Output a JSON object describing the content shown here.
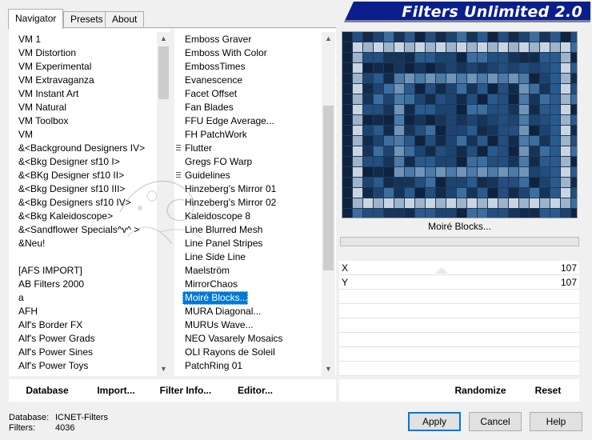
{
  "tabs": [
    "Navigator",
    "Presets",
    "About"
  ],
  "banner": {
    "title": "Filters Unlimited 2.0"
  },
  "categories": [
    {
      "label": "VM 1"
    },
    {
      "label": "VM Distortion"
    },
    {
      "label": "VM Experimental"
    },
    {
      "label": "VM Extravaganza"
    },
    {
      "label": "VM Instant Art"
    },
    {
      "label": "VM Natural"
    },
    {
      "label": "VM Toolbox"
    },
    {
      "label": "VM"
    },
    {
      "label": "&<Background Designers IV>"
    },
    {
      "label": "&<Bkg Designer sf10 I>"
    },
    {
      "label": "&<BKg Designer sf10 II>"
    },
    {
      "label": "&<Bkg Designer sf10 III>"
    },
    {
      "label": "&<Bkg Designers sf10 IV>"
    },
    {
      "label": "&<Bkg Kaleidoscope>"
    },
    {
      "label": "&<Sandflower Specials^v^ >"
    },
    {
      "label": "&Neu!"
    },
    {
      "label": ""
    },
    {
      "label": "[AFS IMPORT]"
    },
    {
      "label": "AB Filters 2000"
    },
    {
      "label": "a"
    },
    {
      "label": "AFH"
    },
    {
      "label": "Alf's Border FX"
    },
    {
      "label": "Alf's Power Grads"
    },
    {
      "label": "Alf's Power Sines"
    },
    {
      "label": "Alf's Power Toys"
    }
  ],
  "filters": [
    {
      "label": "Emboss Graver",
      "folder": false
    },
    {
      "label": "Emboss With Color",
      "folder": false
    },
    {
      "label": "EmbossTimes",
      "folder": false
    },
    {
      "label": "Evanescence",
      "folder": false
    },
    {
      "label": "Facet Offset",
      "folder": false
    },
    {
      "label": "Fan Blades",
      "folder": false
    },
    {
      "label": "FFU Edge Average...",
      "folder": false
    },
    {
      "label": "FH PatchWork",
      "folder": false
    },
    {
      "label": "Flutter",
      "folder": true
    },
    {
      "label": "Gregs FO Warp",
      "folder": false
    },
    {
      "label": "Guidelines",
      "folder": true
    },
    {
      "label": "Hinzeberg's Mirror 01",
      "folder": false
    },
    {
      "label": "Hinzeberg's Mirror 02",
      "folder": false
    },
    {
      "label": "Kaleidoscope 8",
      "folder": false
    },
    {
      "label": "Line Blurred Mesh",
      "folder": false
    },
    {
      "label": "Line Panel Stripes",
      "folder": false
    },
    {
      "label": "Line Side Line",
      "folder": false
    },
    {
      "label": "Maelström",
      "folder": false
    },
    {
      "label": "MirrorChaos",
      "folder": false
    },
    {
      "label": "Moiré Blocks...",
      "folder": false,
      "selected": true
    },
    {
      "label": "MURA Diagonal...",
      "folder": false
    },
    {
      "label": "MURUs Wave...",
      "folder": false
    },
    {
      "label": "NEO Vasarely Mosaics",
      "folder": false
    },
    {
      "label": "OLI Rayons de Soleil",
      "folder": false
    },
    {
      "label": "PatchRing 01",
      "folder": false
    }
  ],
  "preview": {
    "filter_name": "Moiré Blocks..."
  },
  "controls": [
    {
      "label": "X",
      "value": "107"
    },
    {
      "label": "Y",
      "value": "107"
    }
  ],
  "bottom_links": {
    "database": "Database",
    "import": "Import...",
    "filter_info": "Filter Info...",
    "editor": "Editor...",
    "randomize": "Randomize",
    "reset": "Reset"
  },
  "buttons": {
    "apply": "Apply",
    "cancel": "Cancel",
    "help": "Help"
  },
  "status": {
    "database_label": "Database:",
    "database_value": "ICNET-Filters",
    "filters_label": "Filters:",
    "filters_value": "4036"
  },
  "colors": {
    "banner": "#0b1f8c",
    "selection": "#0078d7"
  }
}
